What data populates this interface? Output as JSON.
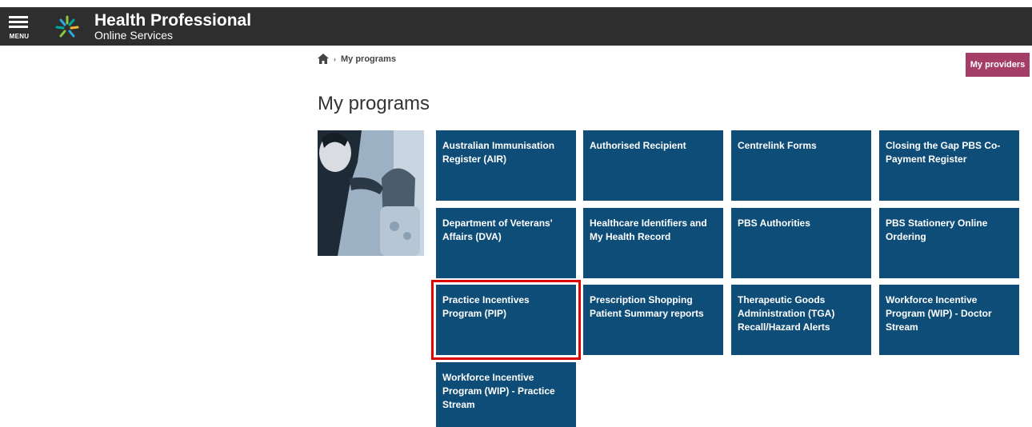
{
  "header": {
    "menu_label": "MENU",
    "brand_title": "Health Professional",
    "brand_subtitle": "Online Services"
  },
  "breadcrumb": {
    "current": "My programs"
  },
  "providers_button": "My providers",
  "page_title": "My programs",
  "programs": [
    "Australian Immunisation Register (AIR)",
    "Authorised Recipient",
    "Centrelink Forms",
    "Closing the Gap PBS Co-Payment Register",
    "Department of Veterans' Affairs (DVA)",
    "Healthcare Identifiers and My Health Record",
    "PBS Authorities",
    "PBS Stationery Online Ordering",
    "Practice Incentives Program (PIP)",
    "Prescription Shopping Patient Summary reports",
    "Therapeutic Goods Administration (TGA) Recall/Hazard Alerts",
    "Workforce Incentive Program (WIP) - Doctor Stream",
    "Workforce Incentive Program (WIP) - Practice Stream"
  ],
  "colors": {
    "topbar": "#2e2e2e",
    "tile": "#0e4d78",
    "providers_button": "#a53e66",
    "highlight": "#e00000"
  }
}
